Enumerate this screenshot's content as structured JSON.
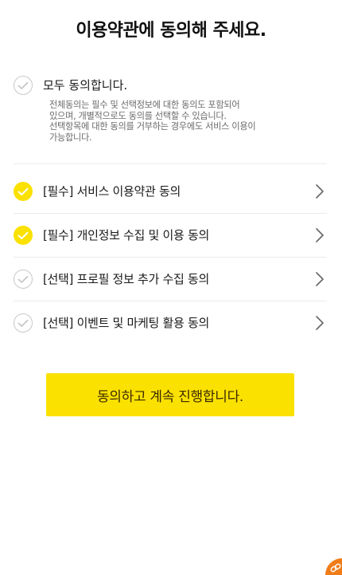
{
  "title": "이용약관에 동의해 주세요.",
  "agree_all": {
    "label": "모두 동의합니다.",
    "checked": false,
    "description": [
      "전체동의는 필수 및 선택정보에 대한 동의도 포함되어",
      "있으며, 개별적으로도 동의를 선택할 수 있습니다.",
      "선택항목에 대한 동의를 거부하는 경우에도 서비스 이용이",
      "가능합니다."
    ]
  },
  "terms": [
    {
      "label": "[필수] 서비스 이용약관 동의",
      "checked": true,
      "icon": "chevron-right-icon"
    },
    {
      "label": "[필수] 개인정보 수집 및 이용 동의",
      "checked": true,
      "icon": "chevron-right-icon"
    },
    {
      "label": "[선택] 프로필 정보 추가 수집 동의",
      "checked": false,
      "icon": "chevron-right-icon"
    },
    {
      "label": "[선택] 이벤트 및 마케팅 활용 동의",
      "checked": false,
      "icon": "chevron-right-icon"
    }
  ],
  "cta": {
    "label": "동의하고 계속 진행합니다."
  },
  "colors": {
    "accent": "#fae100",
    "check_off_border": "#c8c8c8",
    "fab": "#f07c18"
  }
}
